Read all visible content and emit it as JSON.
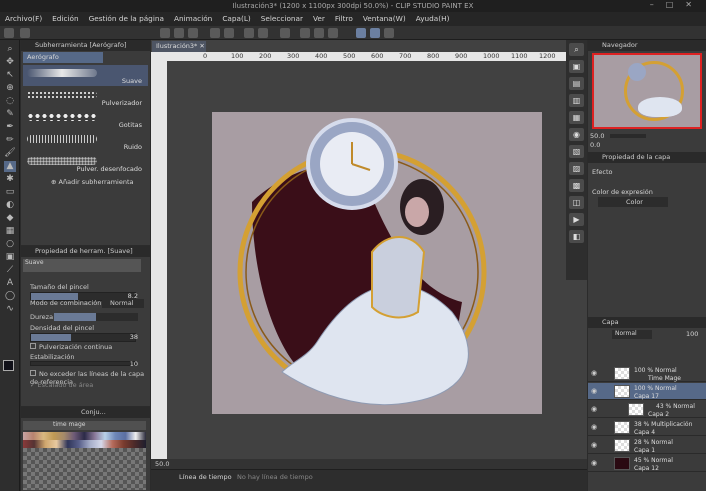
{
  "titlebar": {
    "title": "Ilustración3* (1200 x 1100px 300dpi 50.0%)  - CLIP STUDIO PAINT EX"
  },
  "menu": [
    "Archivo(F)",
    "Edición",
    "Gestión de la página",
    "Animación",
    "Capa(L)",
    "Seleccionar",
    "Ver",
    "Filtro",
    "Ventana(W)",
    "Ayuda(H)"
  ],
  "subtool": {
    "tab_label": "Subherramienta [Aerógrafo]",
    "group_label": "Aerógrafo",
    "brushes": [
      "Suave",
      "Pulverizador",
      "Gotitas",
      "Ruido",
      "Pulver. desenfocado"
    ],
    "add_label": "Añadir subherramienta"
  },
  "tool_property": {
    "title": "Propiedad de herram. [Suave]",
    "preset": "Suave",
    "brush_size_label": "Tamaño del pincel",
    "brush_size_value": "8.2",
    "brush_size_fraction": 0.45,
    "blend_label": "Modo de combinación",
    "blend_value": "Normal",
    "hardness_label": "Dureza",
    "density_label": "Densidad del pincel",
    "density_value": "38",
    "density_fraction": 0.38,
    "continuous_label": "Pulverización continua",
    "stabilization_label": "Estabilización",
    "stabilization_value": "10",
    "ref_layer_label": "No exceder las líneas de la capa de referencia",
    "area_scaling_label": "Escalado de área"
  },
  "color_set": {
    "tab_label": "Conju...",
    "set_name": "time mage"
  },
  "document": {
    "tab_label": "Ilustración3*",
    "zoom": "50.0",
    "ruler_ticks": [
      "0",
      "100",
      "200",
      "300",
      "400",
      "500",
      "600",
      "700",
      "800",
      "900",
      "1000",
      "1100",
      "1200"
    ]
  },
  "timeline": {
    "tab_label": "Línea de tiempo",
    "message": "No hay línea de tiempo"
  },
  "navigator": {
    "title": "Navegador",
    "zoom": "50.0",
    "angle": "0.0"
  },
  "layer_property": {
    "title": "Propiedad de la capa",
    "effect_label": "Efecto",
    "expression_label": "Color de expresión",
    "expression_value": "Color"
  },
  "layers": {
    "tab_label": "Capa",
    "blend": "Normal",
    "opacity": "100",
    "rows": [
      {
        "line1": "100 % Normal",
        "line2": "Time Mage"
      },
      {
        "line1": "100 % Normal",
        "line2": "Capa 17"
      },
      {
        "line1": "43 % Normal",
        "line2": "Capa 2"
      },
      {
        "line1": "38 % Multiplicación",
        "line2": "Capa 4"
      },
      {
        "line1": "28 % Normal",
        "line2": "Capa 1"
      },
      {
        "line1": "45 % Normal",
        "line2": "Capa 12"
      }
    ]
  },
  "colors": {
    "accent": "#566988",
    "paper": "#a89da3",
    "ring_gold": "#d4a033"
  }
}
